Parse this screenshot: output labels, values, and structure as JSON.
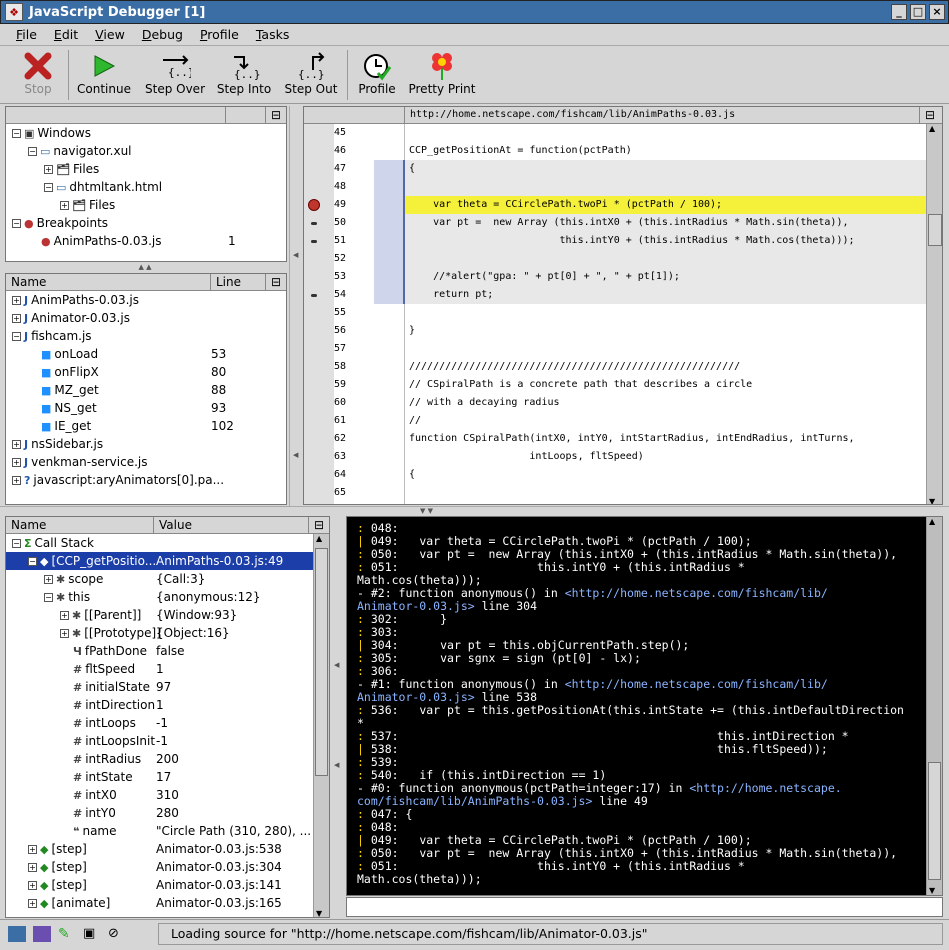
{
  "window": {
    "title": "JavaScript Debugger  [1]"
  },
  "menu": [
    "File",
    "Edit",
    "View",
    "Debug",
    "Profile",
    "Tasks"
  ],
  "toolbar": [
    {
      "label": "Stop",
      "icon": "stop-icon",
      "disabled": true
    },
    {
      "label": "Continue",
      "icon": "continue-icon"
    },
    {
      "label": "Step Over",
      "icon": "step-over-icon"
    },
    {
      "label": "Step Into",
      "icon": "step-into-icon"
    },
    {
      "label": "Step Out",
      "icon": "step-out-icon"
    },
    {
      "label": "Profile",
      "icon": "profile-icon"
    },
    {
      "label": "Pretty Print",
      "icon": "pretty-print-icon"
    }
  ],
  "windows_tree": [
    {
      "label": "Windows",
      "indent": 0,
      "toggle": "−",
      "icon": "windows"
    },
    {
      "label": "navigator.xul",
      "indent": 1,
      "toggle": "−",
      "icon": "window"
    },
    {
      "label": "Files",
      "indent": 2,
      "toggle": "+",
      "icon": "files"
    },
    {
      "label": "dhtmltank.html",
      "indent": 2,
      "toggle": "−",
      "icon": "window"
    },
    {
      "label": "Files",
      "indent": 3,
      "toggle": "+",
      "icon": "files"
    },
    {
      "label": "Breakpoints",
      "indent": 0,
      "toggle": "−",
      "icon": "breakpoints"
    },
    {
      "label": "AnimPaths-0.03.js",
      "indent": 1,
      "toggle": "",
      "icon": "breakpoint",
      "value": "1"
    }
  ],
  "scripts": {
    "headers": [
      "Name",
      "Line"
    ],
    "rows": [
      {
        "label": "AnimPaths-0.03.js",
        "indent": 0,
        "toggle": "+",
        "icon": "script-j",
        "line": ""
      },
      {
        "label": "Animator-0.03.js",
        "indent": 0,
        "toggle": "+",
        "icon": "script-j",
        "line": ""
      },
      {
        "label": "fishcam.js",
        "indent": 0,
        "toggle": "−",
        "icon": "script-j",
        "line": ""
      },
      {
        "label": "onLoad",
        "indent": 1,
        "toggle": "",
        "icon": "function",
        "line": "53"
      },
      {
        "label": "onFlipX",
        "indent": 1,
        "toggle": "",
        "icon": "function",
        "line": "80"
      },
      {
        "label": "MZ_get",
        "indent": 1,
        "toggle": "",
        "icon": "function",
        "line": "88"
      },
      {
        "label": "NS_get",
        "indent": 1,
        "toggle": "",
        "icon": "function",
        "line": "93"
      },
      {
        "label": "IE_get",
        "indent": 1,
        "toggle": "",
        "icon": "function",
        "line": "102"
      },
      {
        "label": "nsSidebar.js",
        "indent": 0,
        "toggle": "+",
        "icon": "script-j",
        "line": ""
      },
      {
        "label": "venkman-service.js",
        "indent": 0,
        "toggle": "+",
        "icon": "script-j",
        "line": ""
      },
      {
        "label": "javascript:aryAnimators[0].pa...",
        "indent": 0,
        "toggle": "+",
        "icon": "script-q",
        "line": ""
      }
    ]
  },
  "source": {
    "url": "http://home.netscape.com/fishcam/lib/AnimPaths-0.03.js",
    "lines": [
      {
        "n": "45",
        "t": "",
        "mark": ""
      },
      {
        "n": "46",
        "t": "CCP_getPositionAt = function(pctPath)",
        "mark": ""
      },
      {
        "n": "47",
        "t": "{",
        "mark": ""
      },
      {
        "n": "48",
        "t": "",
        "mark": ""
      },
      {
        "n": "49",
        "t": "    var theta = CCirclePath.twoPi * (pctPath / 100);",
        "mark": "bp"
      },
      {
        "n": "50",
        "t": "    var pt =  new Array (this.intX0 + (this.intRadius * Math.sin(theta)),",
        "mark": "dash"
      },
      {
        "n": "51",
        "t": "                         this.intY0 + (this.intRadius * Math.cos(theta)));",
        "mark": "dash"
      },
      {
        "n": "52",
        "t": "",
        "mark": ""
      },
      {
        "n": "53",
        "t": "    //*alert(\"gpa: \" + pt[0] + \", \" + pt[1]);",
        "mark": ""
      },
      {
        "n": "54",
        "t": "    return pt;",
        "mark": "dash"
      },
      {
        "n": "55",
        "t": "",
        "mark": ""
      },
      {
        "n": "56",
        "t": "}",
        "mark": ""
      },
      {
        "n": "57",
        "t": "",
        "mark": ""
      },
      {
        "n": "58",
        "t": "///////////////////////////////////////////////////////",
        "mark": ""
      },
      {
        "n": "59",
        "t": "// CSpiralPath is a concrete path that describes a circle",
        "mark": ""
      },
      {
        "n": "60",
        "t": "// with a decaying radius",
        "mark": ""
      },
      {
        "n": "61",
        "t": "//",
        "mark": ""
      },
      {
        "n": "62",
        "t": "function CSpiralPath(intX0, intY0, intStartRadius, intEndRadius, intTurns,",
        "mark": ""
      },
      {
        "n": "63",
        "t": "                    intLoops, fltSpeed)",
        "mark": ""
      },
      {
        "n": "64",
        "t": "{",
        "mark": ""
      },
      {
        "n": "65",
        "t": "",
        "mark": ""
      }
    ]
  },
  "stack": {
    "headers": [
      "Name",
      "Value"
    ],
    "rows": [
      {
        "label": "Call Stack",
        "indent": 0,
        "toggle": "−",
        "icon": "sigma",
        "value": ""
      },
      {
        "label": "[CCP_getPositio...",
        "indent": 1,
        "toggle": "−",
        "icon": "frame",
        "value": "AnimPaths-0.03.js:49",
        "selected": true
      },
      {
        "label": "scope",
        "indent": 2,
        "toggle": "+",
        "icon": "star",
        "value": "{Call:3}"
      },
      {
        "label": "this",
        "indent": 2,
        "toggle": "−",
        "icon": "star",
        "value": "{anonymous:12}"
      },
      {
        "label": "[[Parent]]",
        "indent": 3,
        "toggle": "+",
        "icon": "star",
        "value": "{Window:93}"
      },
      {
        "label": "[[Prototype]]",
        "indent": 3,
        "toggle": "+",
        "icon": "star",
        "value": "{Object:16}"
      },
      {
        "label": "fPathDone",
        "indent": 3,
        "toggle": "",
        "icon": "bool",
        "value": "false"
      },
      {
        "label": "fltSpeed",
        "indent": 3,
        "toggle": "",
        "icon": "hash",
        "value": "1"
      },
      {
        "label": "initialState",
        "indent": 3,
        "toggle": "",
        "icon": "hash",
        "value": "97"
      },
      {
        "label": "intDirection",
        "indent": 3,
        "toggle": "",
        "icon": "hash",
        "value": "1"
      },
      {
        "label": "intLoops",
        "indent": 3,
        "toggle": "",
        "icon": "hash",
        "value": "-1"
      },
      {
        "label": "intLoopsInit",
        "indent": 3,
        "toggle": "",
        "icon": "hash",
        "value": "-1"
      },
      {
        "label": "intRadius",
        "indent": 3,
        "toggle": "",
        "icon": "hash",
        "value": "200"
      },
      {
        "label": "intState",
        "indent": 3,
        "toggle": "",
        "icon": "hash",
        "value": "17"
      },
      {
        "label": "intX0",
        "indent": 3,
        "toggle": "",
        "icon": "hash",
        "value": "310"
      },
      {
        "label": "intY0",
        "indent": 3,
        "toggle": "",
        "icon": "hash",
        "value": "280"
      },
      {
        "label": "name",
        "indent": 3,
        "toggle": "",
        "icon": "str",
        "value": "\"Circle Path (310, 280), ..."
      },
      {
        "label": "[step]",
        "indent": 1,
        "toggle": "+",
        "icon": "frame",
        "value": "Animator-0.03.js:538"
      },
      {
        "label": "[step]",
        "indent": 1,
        "toggle": "+",
        "icon": "frame",
        "value": "Animator-0.03.js:304"
      },
      {
        "label": "[step]",
        "indent": 1,
        "toggle": "+",
        "icon": "frame",
        "value": "Animator-0.03.js:141"
      },
      {
        "label": "[animate]",
        "indent": 1,
        "toggle": "+",
        "icon": "frame",
        "value": "Animator-0.03.js:165"
      }
    ]
  },
  "console": [
    [
      {
        "c": "ln",
        "t": ": "
      },
      {
        "c": "w",
        "t": "048:"
      }
    ],
    [
      {
        "c": "ln",
        "t": "| "
      },
      {
        "c": "w",
        "t": "049:   var theta = CCirclePath.twoPi * (pctPath / 100);"
      }
    ],
    [
      {
        "c": "ln",
        "t": ": "
      },
      {
        "c": "w",
        "t": "050:   var pt =  new Array (this.intX0 + (this.intRadius * Math.sin(theta)),"
      }
    ],
    [
      {
        "c": "ln",
        "t": ": "
      },
      {
        "c": "w",
        "t": "051:                    this.intY0 + (this.intRadius *"
      }
    ],
    [
      {
        "c": "w",
        "t": "Math.cos(theta)));"
      }
    ],
    [
      {
        "c": "w",
        "t": "- #2: function anonymous() in "
      },
      {
        "c": "bl",
        "t": "<http://home.netscape.com/fishcam/lib/"
      }
    ],
    [
      {
        "c": "bl",
        "t": "Animator-0.03.js>"
      },
      {
        "c": "w",
        "t": " line 304"
      }
    ],
    [
      {
        "c": "ln",
        "t": ": "
      },
      {
        "c": "w",
        "t": "302:      }"
      }
    ],
    [
      {
        "c": "ln",
        "t": ": "
      },
      {
        "c": "w",
        "t": "303:"
      }
    ],
    [
      {
        "c": "ln",
        "t": "| "
      },
      {
        "c": "w",
        "t": "304:      var pt = this.objCurrentPath.step();"
      }
    ],
    [
      {
        "c": "ln",
        "t": ": "
      },
      {
        "c": "w",
        "t": "305:      var sgnx = sign (pt[0] - lx);"
      }
    ],
    [
      {
        "c": "ln",
        "t": ": "
      },
      {
        "c": "w",
        "t": "306:"
      }
    ],
    [
      {
        "c": "w",
        "t": "- #1: function anonymous() in "
      },
      {
        "c": "bl",
        "t": "<http://home.netscape.com/fishcam/lib/"
      }
    ],
    [
      {
        "c": "bl",
        "t": "Animator-0.03.js>"
      },
      {
        "c": "w",
        "t": " line 538"
      }
    ],
    [
      {
        "c": "ln",
        "t": ": "
      },
      {
        "c": "w",
        "t": "536:   var pt = this.getPositionAt(this.intState += (this.intDefaultDirection"
      }
    ],
    [
      {
        "c": "w",
        "t": "*"
      }
    ],
    [
      {
        "c": "ln",
        "t": ": "
      },
      {
        "c": "w",
        "t": "537:                                              this.intDirection *"
      }
    ],
    [
      {
        "c": "ln",
        "t": "| "
      },
      {
        "c": "w",
        "t": "538:                                              this.fltSpeed));"
      }
    ],
    [
      {
        "c": "ln",
        "t": ": "
      },
      {
        "c": "w",
        "t": "539:"
      }
    ],
    [
      {
        "c": "ln",
        "t": ": "
      },
      {
        "c": "w",
        "t": "540:   if (this.intDirection == 1)"
      }
    ],
    [
      {
        "c": "w",
        "t": "- #0: function anonymous(pctPath=integer:17) in "
      },
      {
        "c": "bl",
        "t": "<http://home.netscape."
      }
    ],
    [
      {
        "c": "bl",
        "t": "com/fishcam/lib/AnimPaths-0.03.js>"
      },
      {
        "c": "w",
        "t": " line 49"
      }
    ],
    [
      {
        "c": "ln",
        "t": ": "
      },
      {
        "c": "w",
        "t": "047: {"
      }
    ],
    [
      {
        "c": "ln",
        "t": ": "
      },
      {
        "c": "w",
        "t": "048:"
      }
    ],
    [
      {
        "c": "ln",
        "t": "| "
      },
      {
        "c": "w",
        "t": "049:   var theta = CCirclePath.twoPi * (pctPath / 100);"
      }
    ],
    [
      {
        "c": "ln",
        "t": ": "
      },
      {
        "c": "w",
        "t": "050:   var pt =  new Array (this.intX0 + (this.intRadius * Math.sin(theta)),"
      }
    ],
    [
      {
        "c": "ln",
        "t": ": "
      },
      {
        "c": "w",
        "t": "051:                    this.intY0 + (this.intRadius *"
      }
    ],
    [
      {
        "c": "w",
        "t": "Math.cos(theta)));"
      }
    ]
  ],
  "status": {
    "text": "Loading source for \"http://home.netscape.com/fishcam/lib/Animator-0.03.js\""
  }
}
